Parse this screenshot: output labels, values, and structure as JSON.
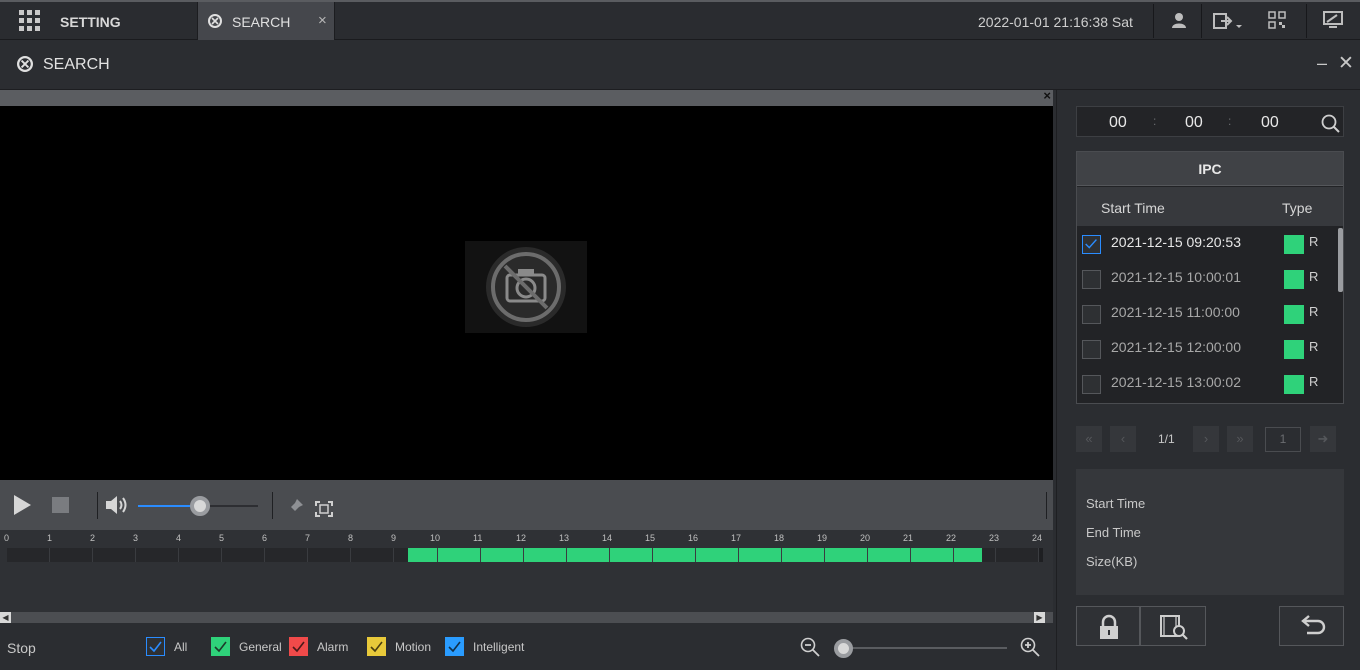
{
  "topbar": {
    "setting_label": "SETTING",
    "search_tab_label": "SEARCH",
    "tab_close": "×",
    "datetime": "2022-01-01 21:16:38 Sat"
  },
  "titlebar": {
    "title": "SEARCH",
    "minimize": "–",
    "close": "✕"
  },
  "video": {
    "close": "×"
  },
  "playback": {
    "volume_level": 0.52
  },
  "timeline": {
    "hour_labels": [
      "0",
      "1",
      "2",
      "3",
      "4",
      "5",
      "6",
      "7",
      "8",
      "9",
      "10",
      "11",
      "12",
      "13",
      "14",
      "15",
      "16",
      "17",
      "18",
      "19",
      "20",
      "21",
      "22",
      "23",
      "24"
    ],
    "recording_start_hour": 9.33,
    "recording_end_hour": 22.67,
    "recording_color": "#2fd27a"
  },
  "bottom": {
    "status": "Stop",
    "legend": [
      {
        "label": "All",
        "color": "#2a8cff"
      },
      {
        "label": "General",
        "color": "#2fd27a"
      },
      {
        "label": "Alarm",
        "color": "#f04a4a"
      },
      {
        "label": "Motion",
        "color": "#e8c93a"
      },
      {
        "label": "Intelligent",
        "color": "#2a9cff"
      }
    ]
  },
  "right": {
    "time": {
      "h": "00",
      "m": "00",
      "s": "00",
      "sep": ":"
    },
    "table": {
      "title": "IPC",
      "col_start": "Start Time",
      "col_type": "Type",
      "rows": [
        {
          "time": "2021-12-15 09:20:53",
          "type": "R",
          "checked": true
        },
        {
          "time": "2021-12-15 10:00:01",
          "type": "R",
          "checked": false
        },
        {
          "time": "2021-12-15 11:00:00",
          "type": "R",
          "checked": false
        },
        {
          "time": "2021-12-15 12:00:00",
          "type": "R",
          "checked": false
        },
        {
          "time": "2021-12-15 13:00:02",
          "type": "R",
          "checked": false
        }
      ]
    },
    "pager": {
      "page": "1/1",
      "goto": "1"
    },
    "info": {
      "start": "Start Time",
      "end": "End Time",
      "size": "Size(KB)"
    }
  }
}
